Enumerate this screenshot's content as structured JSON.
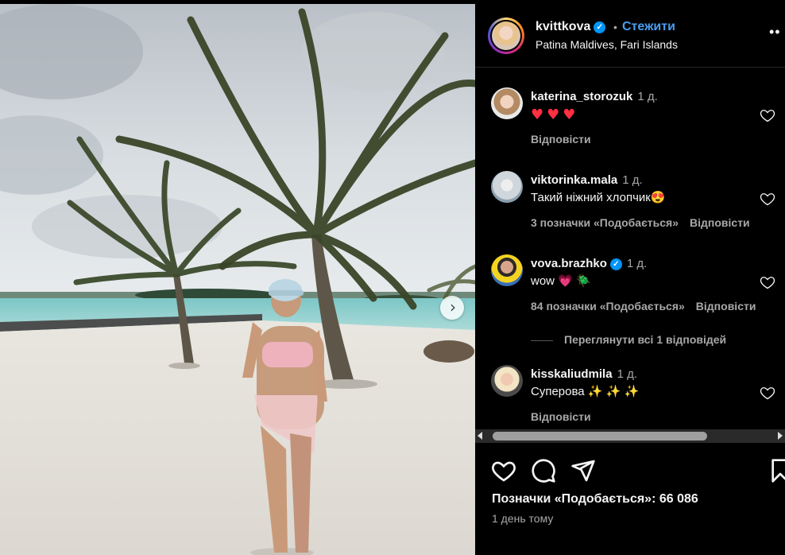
{
  "post": {
    "author": "kvittkova",
    "follow_label": "Стежити",
    "dot": "•",
    "location": "Patina Maldives, Fari Islands",
    "more_label": "••",
    "next_label": "›",
    "likes_text": "Позначки «Подобається»: 66 086",
    "time_text": "1 день тому"
  },
  "comments": [
    {
      "user": "katerina_storozuk",
      "time": "1 д.",
      "text": "",
      "hearts": "♥♥♥",
      "likes": "",
      "reply": "Відповісти",
      "verified": false
    },
    {
      "user": "viktorinka.mala",
      "time": "1 д.",
      "text": "Такий ніжний хлопчик",
      "emoji": "😍",
      "likes": "3 позначки «Подобається»",
      "reply": "Відповісти",
      "verified": false
    },
    {
      "user": "vova.brazhko",
      "time": "1 д.",
      "text": "wow",
      "emoji": "💗 🪲",
      "likes": "84 позначки «Подобається»",
      "reply": "Відповісти",
      "verified": true
    },
    {
      "user": "kisskaliudmila",
      "time": "1 д.",
      "text": "Суперова",
      "emoji": "✨ ✨ ✨",
      "likes": "",
      "reply": "Відповісти",
      "verified": false
    }
  ],
  "view_replies": "Переглянути всі 1 відповідей",
  "icons": {
    "verified": "✓",
    "like": "heart-icon",
    "comment": "comment-icon",
    "share": "send-icon",
    "save": "bookmark-icon"
  },
  "colors": {
    "accent_link": "#4a9ef0",
    "verified": "#0095f6",
    "heart_red": "#ff3040"
  }
}
